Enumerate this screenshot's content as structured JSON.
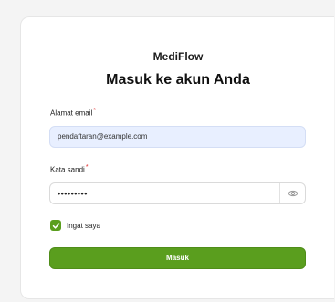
{
  "login": {
    "brand": "MediFlow",
    "heading": "Masuk ke akun Anda",
    "email_label": "Alamat email",
    "email_value": "pendaftaran@example.com",
    "password_label": "Kata sandi",
    "password_value": "•••••••••",
    "required_mark": "*",
    "remember_label": "Ingat saya",
    "remember_checked": true,
    "submit_label": "Masuk"
  },
  "icons": {
    "show_password": "eye-icon",
    "checkbox": "checkmark-icon"
  },
  "colors": {
    "accent": "#5a9e1e",
    "email_field_bg": "#e8efff",
    "required": "#e02424"
  }
}
